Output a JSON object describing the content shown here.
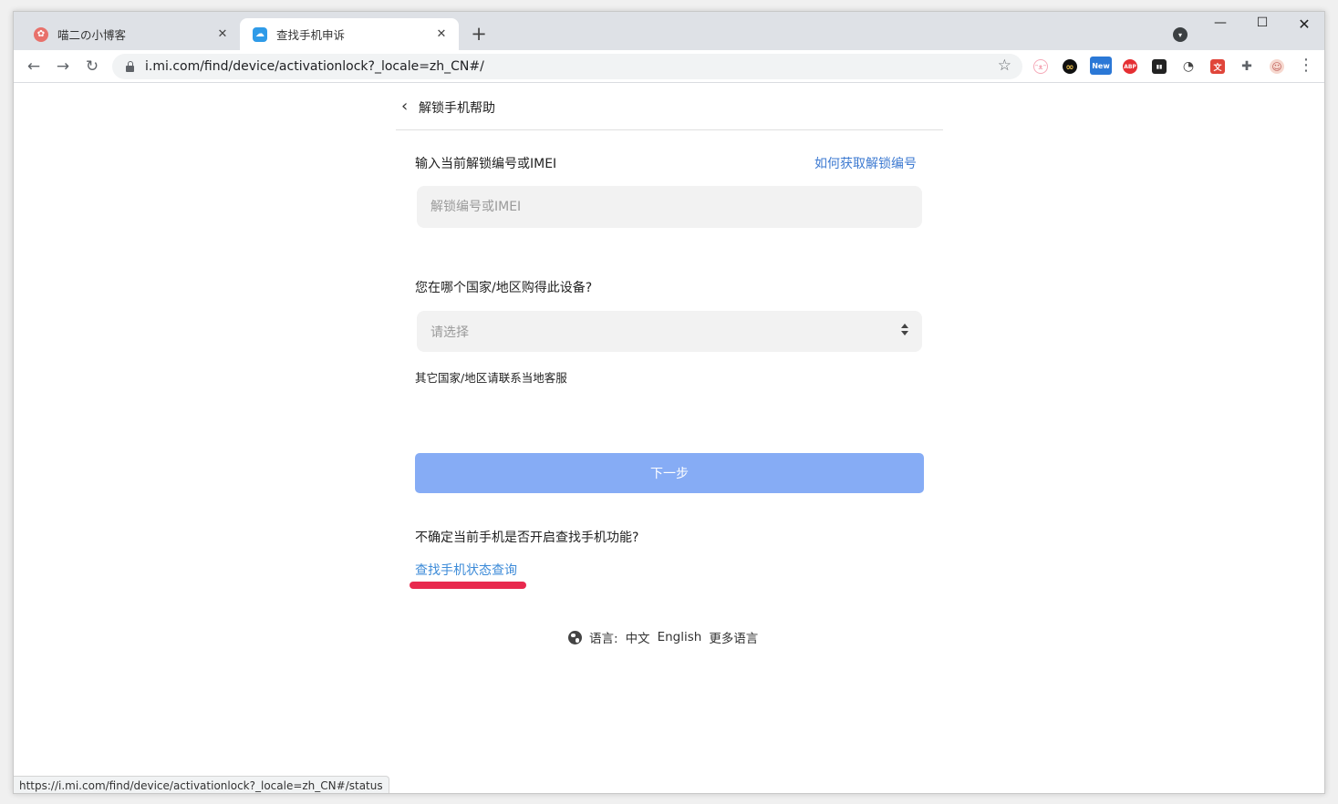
{
  "browser": {
    "tabs": [
      {
        "title": "喵二の小博客",
        "favicon": "cat-blog-icon",
        "favicon_color": "#e8716b",
        "active": false
      },
      {
        "title": "查找手机申诉",
        "favicon": "cloud-icon",
        "favicon_color": "#2f9be8",
        "active": true
      }
    ],
    "new_tab_glyph": "+",
    "tab_search_glyph": "▾",
    "window_controls": {
      "minimize": "—",
      "maximize": "☐",
      "close": "✕"
    },
    "nav": {
      "back": "←",
      "forward": "→",
      "reload": "↻"
    },
    "url": "i.mi.com/find/device/activationlock?_locale=zh_CN#/",
    "bookmark_glyph": "☆",
    "menu_glyph": "⋮",
    "extensions": [
      {
        "name": "cat-face-icon",
        "glyph": "ᵔᴥᵔ",
        "color": "#f5a9b8"
      },
      {
        "name": "infinity-icon",
        "glyph": "∞",
        "color": "#111111"
      },
      {
        "name": "new-badge-icon",
        "glyph": "New",
        "color": "#2b78d6"
      },
      {
        "name": "adblock-icon",
        "glyph": "ABP",
        "color": "#e52f33"
      },
      {
        "name": "trello-icon",
        "glyph": "▮▮",
        "color": "#222222"
      },
      {
        "name": "speedometer-icon",
        "glyph": "◔",
        "color": "#444444"
      },
      {
        "name": "translate-icon",
        "glyph": "文",
        "color": "#e0453a"
      },
      {
        "name": "puzzle-icon",
        "glyph": "✚",
        "color": "#5f6368"
      },
      {
        "name": "profile-avatar-icon",
        "glyph": "☺",
        "color": "#e89a8a"
      }
    ],
    "status_url": "https://i.mi.com/find/device/activationlock?_locale=zh_CN#/status"
  },
  "page": {
    "back_glyph": "‹",
    "title": "解锁手机帮助",
    "unlock_label": "输入当前解锁编号或IMEI",
    "help_link": "如何获取解锁编号",
    "unlock_placeholder": "解锁编号或IMEI",
    "unlock_value": "",
    "country_label": "您在哪个国家/地区购得此设备?",
    "country_placeholder": "请选择",
    "country_note": "其它国家/地区请联系当地客服",
    "next_button": "下一步",
    "uncertain_text": "不确定当前手机是否开启查找手机功能?",
    "status_link": "查找手机状态查询",
    "language": {
      "label": "语言:",
      "options": [
        "中文",
        "English",
        "更多语言"
      ]
    },
    "colors": {
      "link": "#3d7ad1",
      "button": "#86acf5",
      "highlight": "#e8294e"
    }
  }
}
